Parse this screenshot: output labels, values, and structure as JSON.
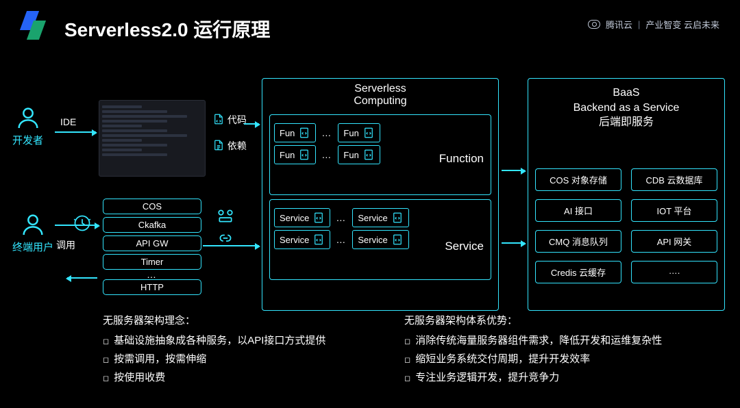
{
  "header": {
    "title": "Serverless2.0 运行原理",
    "brand": "腾讯云",
    "slogan": "产业智变 云启未来"
  },
  "actors": {
    "developer": "开发者",
    "enduser": "终端用户"
  },
  "labels": {
    "ide": "IDE",
    "call": "调用",
    "code": "代码",
    "deps": "依赖"
  },
  "triggers": [
    "COS",
    "Ckafka",
    "API GW",
    "Timer",
    "HTTP"
  ],
  "mid": {
    "title": "Serverless\nComputing",
    "fun": "Fun",
    "service": "Service",
    "fun_label": "Function",
    "svc_label": "Service",
    "dots": "…"
  },
  "baas": {
    "title_1": "BaaS",
    "title_2": "Backend as a Service",
    "title_3": "后端即服务",
    "items": [
      "COS 对象存储",
      "CDB 云数据库",
      "AI 接口",
      "IOT 平台",
      "CMQ 消息队列",
      "API 网关",
      "Credis 云缓存",
      "…."
    ]
  },
  "bottom": {
    "left_title": "无服务器架构理念：",
    "left_items": [
      "基础设施抽象成各种服务，以API接口方式提供",
      "按需调用，按需伸缩",
      "按使用收费"
    ],
    "right_title": "无服务器架构体系优势：",
    "right_items": [
      "消除传统海量服务器组件需求，降低开发和运维复杂性",
      "缩短业务系统交付周期，提升开发效率",
      "专注业务逻辑开发，提升竞争力"
    ]
  }
}
